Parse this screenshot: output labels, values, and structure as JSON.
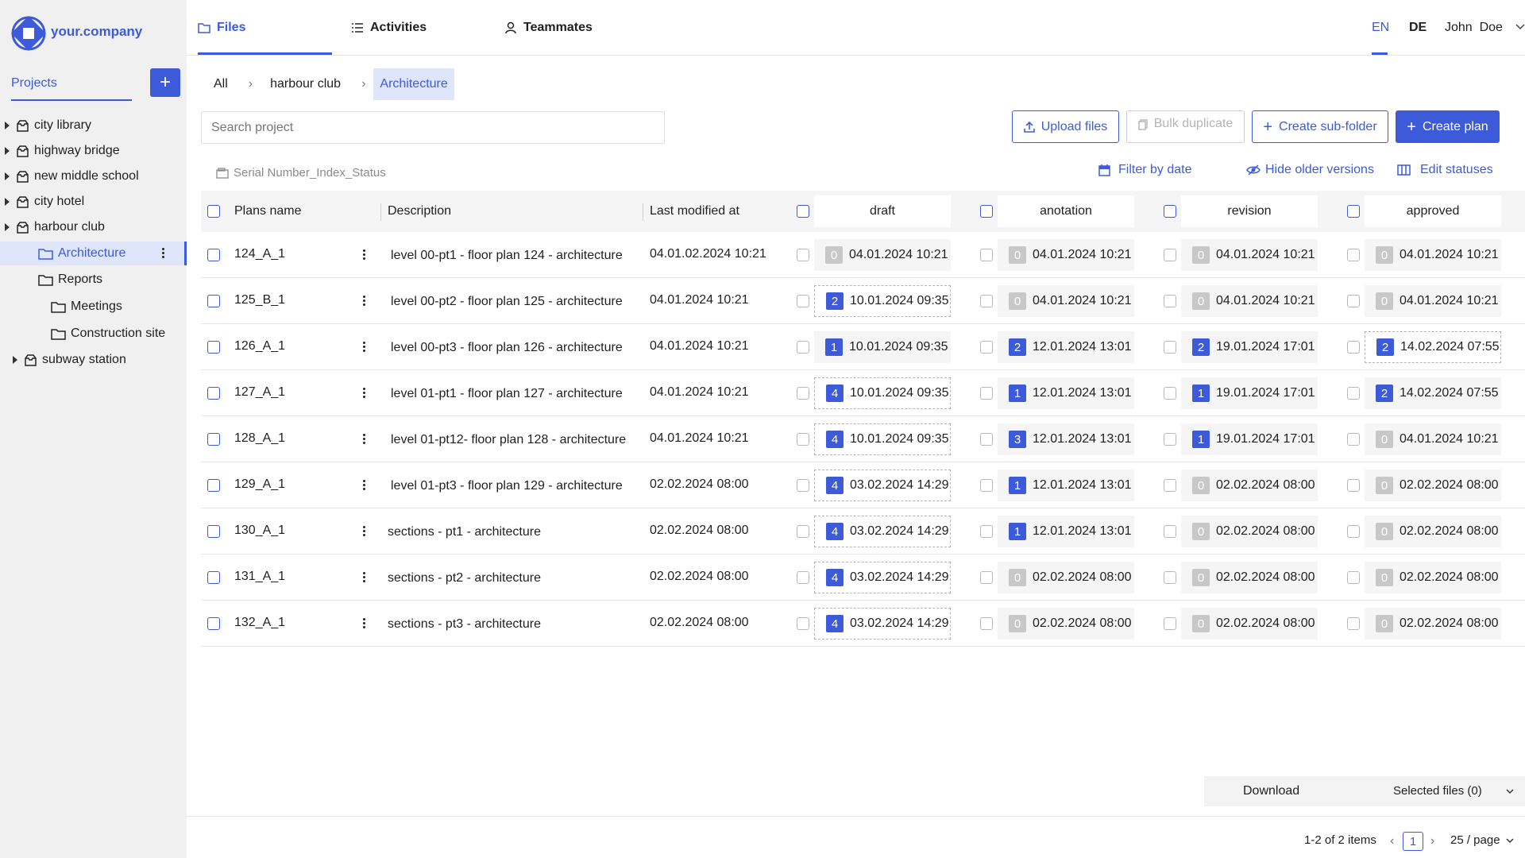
{
  "brand": {
    "name": "your.company",
    "accent": "#3d5bd9"
  },
  "topnav": {
    "tabs": [
      {
        "label": "Files",
        "active": true,
        "icon": "folder-icon"
      },
      {
        "label": "Activities",
        "icon": "list-icon"
      },
      {
        "label": "Teammates",
        "icon": "user-icon"
      }
    ],
    "languages": [
      "EN",
      "DE"
    ],
    "active_language": "EN",
    "user": "John  Doe"
  },
  "sidebar": {
    "projects_tab": "Projects",
    "add_button": "+",
    "tree": [
      {
        "label": "city library",
        "type": "project",
        "expandable": true
      },
      {
        "label": "highway bridge",
        "type": "project",
        "expandable": true
      },
      {
        "label": "new middle school",
        "type": "project",
        "expandable": true
      },
      {
        "label": "city hotel",
        "type": "project",
        "expandable": true
      },
      {
        "label": "harbour club",
        "type": "project",
        "expandable": true,
        "expanded": true
      },
      {
        "label": "Architecture",
        "type": "folder",
        "selected": true
      },
      {
        "label": "Reports",
        "type": "folder"
      },
      {
        "label": "Meetings",
        "type": "folder"
      },
      {
        "label": "Construction site",
        "type": "folder"
      },
      {
        "label": "subway station",
        "type": "project",
        "expandable": true
      }
    ]
  },
  "breadcrumb": [
    "All",
    "harbour club",
    "Architecture"
  ],
  "search": {
    "placeholder": "Search project",
    "value": ""
  },
  "actions": {
    "upload": "Upload files",
    "bulk_duplicate": "Bulk duplicate",
    "create_subfolder": "Create sub-folder",
    "create_plan": "Create plan"
  },
  "naming_hint": "Serial Number_Index_Status",
  "filters": {
    "filter_by_date": "Filter by date",
    "hide_older": "Hide older versions",
    "edit_statuses": "Edit statuses"
  },
  "table": {
    "headers": {
      "name": "Plans name",
      "description": "Description",
      "modified": "Last modified at"
    },
    "status_headers": [
      "draft",
      "anotation",
      "revision",
      "approved"
    ],
    "rows": [
      {
        "name": "124_A_1",
        "description": "level 00-pt1 - floor plan 124 - architecture",
        "modified": "04.01.02.2024 10:21",
        "statuses": [
          {
            "count": "0",
            "date": "04.01.2024 10:21"
          },
          {
            "count": "0",
            "date": "04.01.2024 10:21"
          },
          {
            "count": "0",
            "date": "04.01.2024 10:21"
          },
          {
            "count": "0",
            "date": "04.01.2024 10:21"
          }
        ]
      },
      {
        "name": "125_B_1",
        "description": "level 00-pt2 - floor plan 125 - architecture",
        "modified": "04.01.2024 10:21",
        "statuses": [
          {
            "count": "2",
            "date": "10.01.2024 09:35",
            "current": true
          },
          {
            "count": "0",
            "date": "04.01.2024 10:21"
          },
          {
            "count": "0",
            "date": "04.01.2024 10:21"
          },
          {
            "count": "0",
            "date": "04.01.2024 10:21"
          }
        ]
      },
      {
        "name": "126_A_1",
        "description": "level 00-pt3 - floor plan 126 - architecture",
        "modified": "04.01.2024 10:21",
        "statuses": [
          {
            "count": "1",
            "date": "10.01.2024 09:35"
          },
          {
            "count": "2",
            "date": "12.01.2024 13:01"
          },
          {
            "count": "2",
            "date": "19.01.2024 17:01"
          },
          {
            "count": "2",
            "date": "14.02.2024 07:55",
            "current": true
          }
        ]
      },
      {
        "name": "127_A_1",
        "description": "level 01-pt1 - floor plan 127 - architecture",
        "modified": "04.01.2024 10:21",
        "statuses": [
          {
            "count": "4",
            "date": "10.01.2024 09:35",
            "current": true
          },
          {
            "count": "1",
            "date": "12.01.2024 13:01"
          },
          {
            "count": "1",
            "date": "19.01.2024 17:01"
          },
          {
            "count": "2",
            "date": "14.02.2024 07:55"
          }
        ]
      },
      {
        "name": "128_A_1",
        "description": "level 01-pt12- floor plan 128 - architecture",
        "modified": "04.01.2024 10:21",
        "statuses": [
          {
            "count": "4",
            "date": "10.01.2024 09:35",
            "current": true
          },
          {
            "count": "3",
            "date": "12.01.2024 13:01"
          },
          {
            "count": "1",
            "date": "19.01.2024 17:01"
          },
          {
            "count": "0",
            "date": "04.01.2024 10:21"
          }
        ]
      },
      {
        "name": "129_A_1",
        "description": "level 01-pt3 - floor plan 129 - architecture",
        "modified": "02.02.2024 08:00",
        "statuses": [
          {
            "count": "4",
            "date": "03.02.2024 14:29",
            "current": true
          },
          {
            "count": "1",
            "date": "12.01.2024 13:01"
          },
          {
            "count": "0",
            "date": "02.02.2024 08:00"
          },
          {
            "count": "0",
            "date": "02.02.2024 08:00"
          }
        ]
      },
      {
        "name": "130_A_1",
        "description": "sections - pt1 - architecture",
        "modified": "02.02.2024 08:00",
        "statuses": [
          {
            "count": "4",
            "date": "03.02.2024 14:29",
            "current": true
          },
          {
            "count": "1",
            "date": "12.01.2024 13:01"
          },
          {
            "count": "0",
            "date": "02.02.2024 08:00"
          },
          {
            "count": "0",
            "date": "02.02.2024 08:00"
          }
        ]
      },
      {
        "name": "131_A_1",
        "description": "sections - pt2 - architecture",
        "modified": "02.02.2024 08:00",
        "statuses": [
          {
            "count": "4",
            "date": "03.02.2024 14:29",
            "current": true
          },
          {
            "count": "0",
            "date": "02.02.2024 08:00"
          },
          {
            "count": "0",
            "date": "02.02.2024 08:00"
          },
          {
            "count": "0",
            "date": "02.02.2024 08:00"
          }
        ]
      },
      {
        "name": "132_A_1",
        "description": "sections - pt3 - architecture",
        "modified": "02.02.2024 08:00",
        "statuses": [
          {
            "count": "4",
            "date": "03.02.2024 14:29",
            "current": true
          },
          {
            "count": "0",
            "date": "02.02.2024 08:00"
          },
          {
            "count": "0",
            "date": "02.02.2024 08:00"
          },
          {
            "count": "0",
            "date": "02.02.2024 08:00"
          }
        ]
      }
    ]
  },
  "download_bar": {
    "label": "Download",
    "selected": "Selected files (0)"
  },
  "pagination": {
    "summary": "1-2 of 2 items",
    "page": "1",
    "page_size": "25 / page"
  }
}
